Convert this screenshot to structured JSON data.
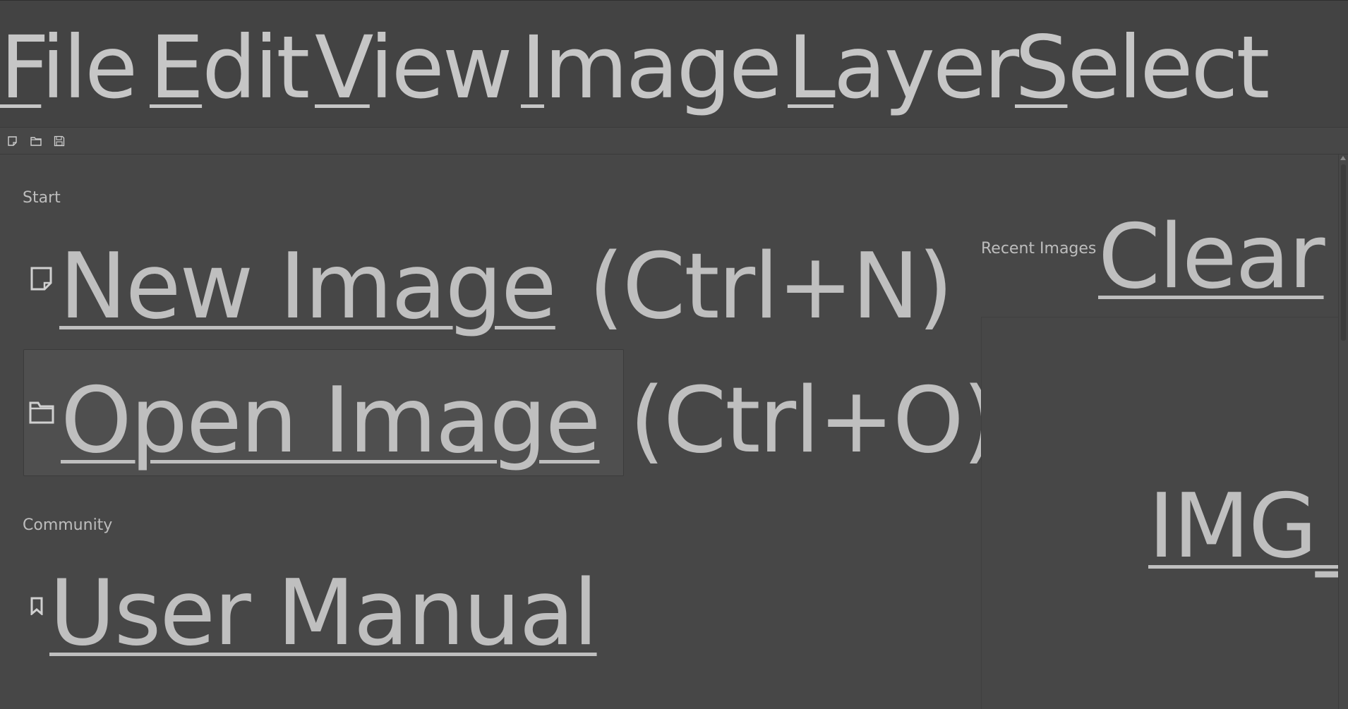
{
  "menubar": {
    "items": [
      {
        "mnemonic": "F",
        "rest": "ile"
      },
      {
        "mnemonic": "E",
        "rest": "dit"
      },
      {
        "mnemonic": "V",
        "rest": "iew"
      },
      {
        "mnemonic": "I",
        "rest": "mage"
      },
      {
        "mnemonic": "L",
        "rest": "ayer"
      },
      {
        "mnemonic": "S",
        "rest": "elect"
      }
    ]
  },
  "toolbar": {
    "icons": [
      "new-document-icon",
      "open-folder-icon",
      "save-icon"
    ]
  },
  "start": {
    "heading": "Start",
    "new_image": {
      "label": "New Image",
      "shortcut": "(Ctrl+N)",
      "icon": "new-document-icon"
    },
    "open_image": {
      "label": "Open Image",
      "shortcut": "(Ctrl+O)",
      "icon": "open-folder-icon"
    }
  },
  "community": {
    "heading": "Community",
    "user_manual": {
      "label": "User Manual",
      "icon": "bookmark-icon"
    }
  },
  "recent": {
    "heading": "Recent Images",
    "clear_label": "Clear",
    "item_label": "IMG_"
  },
  "colors": {
    "background": "#474747",
    "menubar": "#434343",
    "text": "#c8c8c8",
    "highlight": "#4f4f4f"
  }
}
